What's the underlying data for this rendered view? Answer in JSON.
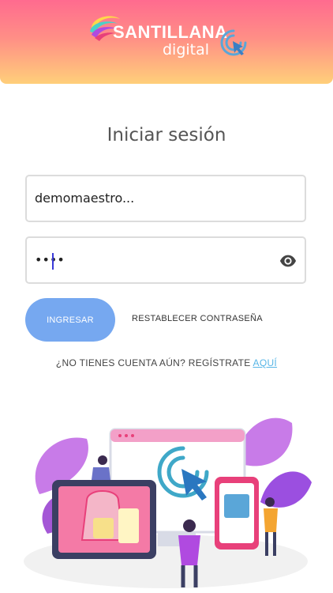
{
  "header": {
    "brand_name": "SANTILLANA",
    "brand_sub": "digital"
  },
  "login": {
    "title": "Iniciar sesión",
    "username_value": "demomaestro...",
    "password_value": "••••",
    "submit_label": "INGRESAR",
    "reset_label": "RESTABLECER CONTRASEÑA",
    "signup_text": "¿NO TIENES CUENTA AÚN? REGÍSTRATE",
    "signup_link": "AQUÍ"
  },
  "colors": {
    "header_top": "#ff6b8f",
    "header_bottom": "#ffcf7a",
    "primary_button": "#76a8f0",
    "link": "#57b5e6"
  },
  "icons": {
    "logo": "santillana-swirl-icon",
    "cursor": "click-cursor-icon",
    "password_toggle": "eye-icon"
  }
}
